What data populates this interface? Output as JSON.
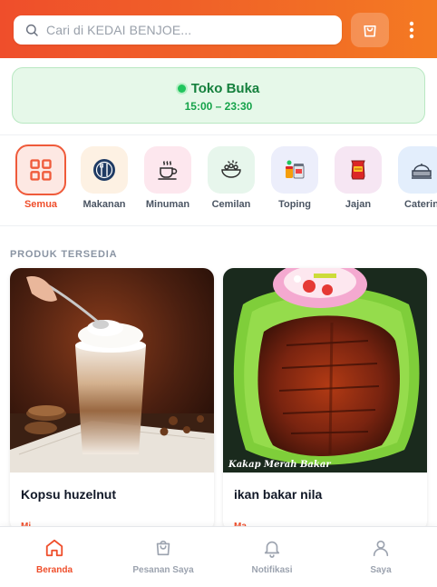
{
  "search": {
    "placeholder": "Cari di KEDAI BENJOE..."
  },
  "store": {
    "status": "Toko Buka",
    "hours": "15:00 – 23:30"
  },
  "categories": [
    {
      "label": "Semua",
      "icon": "grid-icon",
      "active": true
    },
    {
      "label": "Makanan",
      "icon": "plate-cutlery-icon"
    },
    {
      "label": "Minuman",
      "icon": "coffee-cup-icon"
    },
    {
      "label": "Cemilan",
      "icon": "snack-bowl-icon"
    },
    {
      "label": "Toping",
      "icon": "toppings-icon"
    },
    {
      "label": "Jajan",
      "icon": "chips-bag-icon"
    },
    {
      "label": "Caterin",
      "icon": "catering-icon"
    }
  ],
  "section": {
    "title": "PRODUK TERSEDIA"
  },
  "products": [
    {
      "name": "Kopsu huzelnut",
      "image": "hazelnut-latte-photo",
      "category_tag": "Mi"
    },
    {
      "name": "ikan bakar nila",
      "image": "grilled-fish-photo",
      "image_caption": "Kakap Merah Bakar",
      "category_tag": "Ma"
    }
  ],
  "bottom_nav": [
    {
      "label": "Beranda",
      "icon": "home-icon",
      "active": true
    },
    {
      "label": "Pesanan Saya",
      "icon": "shopping-bag-icon"
    },
    {
      "label": "Notifikasi",
      "icon": "bell-icon"
    },
    {
      "label": "Saya",
      "icon": "user-icon"
    }
  ],
  "colors": {
    "accent": "#ef4e2b",
    "accent_end": "#f47a22",
    "success": "#16a34a",
    "success_bg": "#e6f8e9"
  }
}
